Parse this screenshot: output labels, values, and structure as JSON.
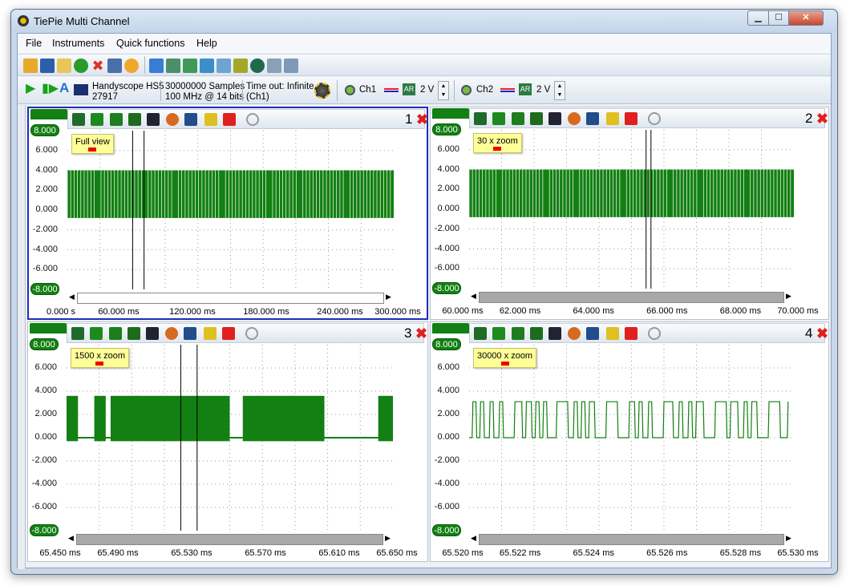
{
  "window": {
    "title": "TiePie Multi Channel"
  },
  "menu": [
    "File",
    "Instruments",
    "Quick functions",
    "Help"
  ],
  "instrument": {
    "name": "Handyscope HS5",
    "serial": "27917",
    "samples": "30000000 Samples",
    "rate": "100 MHz @ 14 bits",
    "timeout": "Time out: Infinite",
    "timeout_ch": "(Ch1)"
  },
  "channels": [
    {
      "label": "Ch1",
      "ar": "AR",
      "range": "2 V"
    },
    {
      "label": "Ch2",
      "ar": "AR",
      "range": "2 V"
    }
  ],
  "colors": {
    "trace": "#128012",
    "selected_border": "#1f2fb5",
    "close": "#e0201c"
  },
  "y_labels": [
    "8.000",
    "6.000",
    "4.000",
    "2.000",
    "0.000",
    "-2.000",
    "-4.000",
    "-6.000",
    "-8.000"
  ],
  "panels": [
    {
      "number": "1",
      "zoom_label": "Full view",
      "x_labels": [
        "0.000 s",
        "60.000 ms",
        "120.000 ms",
        "180.000 ms",
        "240.000 ms",
        "300.000 ms"
      ]
    },
    {
      "number": "2",
      "zoom_label": "30 x zoom",
      "x_labels": [
        "60.000 ms",
        "62.000 ms",
        "64.000 ms",
        "66.000 ms",
        "68.000 ms",
        "70.000 ms"
      ]
    },
    {
      "number": "3",
      "zoom_label": "1500 x zoom",
      "x_labels": [
        "65.450 ms",
        "65.490 ms",
        "65.530 ms",
        "65.570 ms",
        "65.610 ms",
        "65.650 ms"
      ]
    },
    {
      "number": "4",
      "zoom_label": "30000 x zoom",
      "x_labels": [
        "65.520 ms",
        "65.522 ms",
        "65.524 ms",
        "65.526 ms",
        "65.528 ms",
        "65.530 ms"
      ]
    }
  ],
  "icons": {
    "close": "✖",
    "play": "▶",
    "min": "▁",
    "max": "☐"
  }
}
